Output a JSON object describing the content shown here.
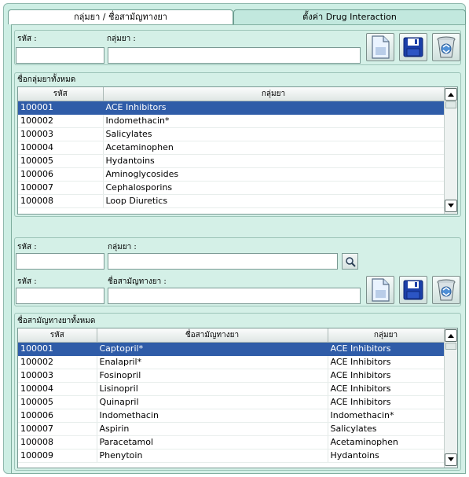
{
  "tabs": [
    {
      "label": "กลุ่มยา / ชื่อสามัญทางยา",
      "active": true
    },
    {
      "label": "ตั้งค่า Drug Interaction",
      "active": false
    }
  ],
  "group_form": {
    "code_label": "รหัส :",
    "code_value": "",
    "name_label": "กลุ่มยา :",
    "name_value": ""
  },
  "group_list": {
    "title": "ชื่อกลุ่มยาทั้งหมด",
    "columns": [
      "รหัส",
      "กลุ่มยา"
    ],
    "selected_index": 0,
    "rows": [
      [
        "100001",
        "ACE Inhibitors"
      ],
      [
        "100002",
        "Indomethacin*"
      ],
      [
        "100003",
        "Salicylates"
      ],
      [
        "100004",
        "Acetaminophen"
      ],
      [
        "100005",
        "Hydantoins"
      ],
      [
        "100006",
        "Aminoglycosides"
      ],
      [
        "100007",
        "Cephalosporins"
      ],
      [
        "100008",
        "Loop Diuretics"
      ]
    ]
  },
  "generic_form": {
    "group_code_label": "รหัส :",
    "group_code_value": "",
    "group_name_label": "กลุ่มยา :",
    "group_name_value": "",
    "code_label": "รหัส :",
    "code_value": "",
    "name_label": "ชื่อสามัญทางยา :",
    "name_value": ""
  },
  "generic_list": {
    "title": "ชื่อสามัญทางยาทั้งหมด",
    "columns": [
      "รหัส",
      "ชื่อสามัญทางยา",
      "กลุ่มยา"
    ],
    "selected_index": 0,
    "rows": [
      [
        "100001",
        "Captopril*",
        "ACE Inhibitors"
      ],
      [
        "100002",
        "Enalapril*",
        "ACE Inhibitors"
      ],
      [
        "100003",
        "Fosinopril",
        "ACE Inhibitors"
      ],
      [
        "100004",
        "Lisinopril",
        "ACE Inhibitors"
      ],
      [
        "100005",
        "Quinapril",
        "ACE Inhibitors"
      ],
      [
        "100006",
        "Indomethacin",
        "Indomethacin*"
      ],
      [
        "100007",
        "Aspirin",
        "Salicylates"
      ],
      [
        "100008",
        "Paracetamol",
        "Acetaminophen"
      ],
      [
        "100009",
        "Phenytoin",
        "Hydantoins"
      ]
    ]
  },
  "icons": {
    "new": "new-document-icon",
    "save": "save-disk-icon",
    "delete": "recycle-bin-icon",
    "search": "search-icon",
    "scroll_up": "chevron-up-icon",
    "scroll_down": "chevron-down-icon"
  },
  "colors": {
    "background": "#cdeee4",
    "selection": "#2f5ca8",
    "save_icon": "#1b3fa8"
  }
}
